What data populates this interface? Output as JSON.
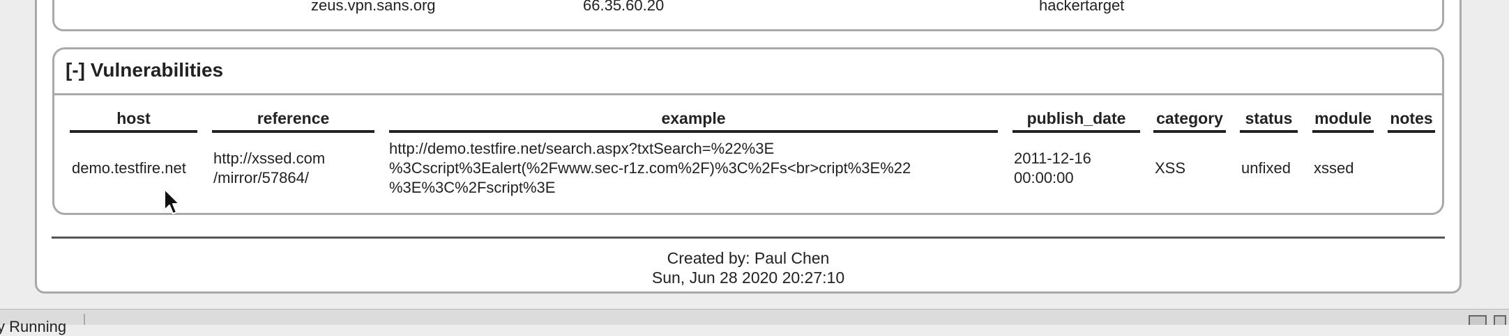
{
  "previous_section": {
    "row": {
      "host": "zeus.vpn.sans.org",
      "ip": "66.35.60.20",
      "source": "hackertarget"
    }
  },
  "vulnerabilities": {
    "title": "[-] Vulnerabilities",
    "columns": [
      "host",
      "reference",
      "example",
      "publish_date",
      "category",
      "status",
      "module",
      "notes"
    ],
    "rows": [
      {
        "host": "demo.testfire.net",
        "reference_line1": "http://xssed.com",
        "reference_line2": "/mirror/57864/",
        "example_line1": "http://demo.testfire.net/search.aspx?txtSearch=%22%3E",
        "example_line2": "%3Cscript%3Ealert(%2Fwww.sec-r1z.com%2F)%3C%2Fs<br>cript%3E%22",
        "example_line3": "%3E%3C%2Fscript%3E",
        "publish_date_line1": "2011-12-16",
        "publish_date_line2": "00:00:00",
        "category": "XSS",
        "status": "unfixed",
        "module": "xssed",
        "notes": ""
      }
    ]
  },
  "footer": {
    "created_by": "Created by: Paul Chen",
    "timestamp": "Sun, Jun 28 2020 20:27:10"
  },
  "status_bar": {
    "text": "y Running"
  },
  "icons": {
    "cursor": "mouse-pointer-icon",
    "status_right": "window-icon"
  }
}
